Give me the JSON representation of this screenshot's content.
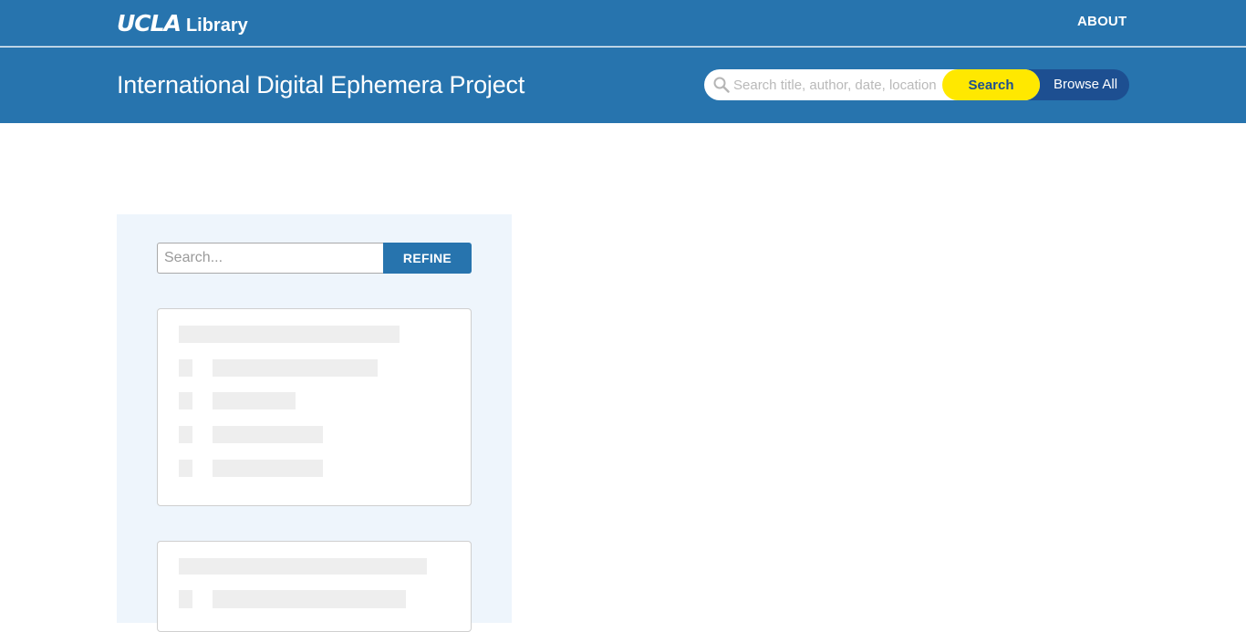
{
  "header": {
    "logo_ucla": "UCLA",
    "logo_library": "Library",
    "about_label": "ABOUT",
    "project_title": "International Digital Ephemera Project",
    "search_placeholder": "Search title, author, date, location",
    "search_button_label": "Search",
    "browse_all_label": "Browse All"
  },
  "sidebar": {
    "refine_placeholder": "Search...",
    "refine_button_label": "REFINE"
  },
  "colors": {
    "primary_blue": "#2774ae",
    "dark_blue": "#1d4f91",
    "accent_yellow": "#ffe800",
    "panel_background": "#eef5fc",
    "skeleton_gray": "#eeeeee"
  },
  "icons": {
    "search": "magnifier-icon"
  }
}
